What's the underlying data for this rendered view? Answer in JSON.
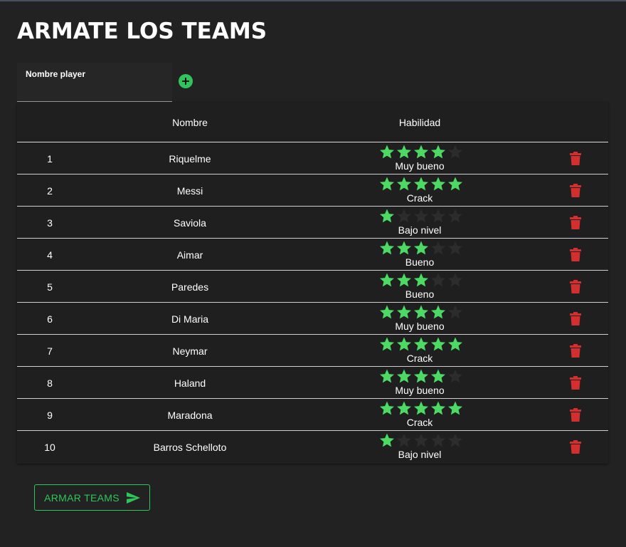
{
  "page": {
    "title": "ARMATE LOS TEAMS"
  },
  "player_input": {
    "label": "Nombre player",
    "value": "",
    "add_icon": "add-circle-icon"
  },
  "table": {
    "headers": {
      "name": "Nombre",
      "skill": "Habilidad"
    },
    "rows": [
      {
        "num": "1",
        "name": "Riquelme",
        "rating": 4,
        "label": "Muy bueno"
      },
      {
        "num": "2",
        "name": "Messi",
        "rating": 5,
        "label": "Crack"
      },
      {
        "num": "3",
        "name": "Saviola",
        "rating": 1,
        "label": "Bajo nivel"
      },
      {
        "num": "4",
        "name": "Aimar",
        "rating": 3,
        "label": "Bueno"
      },
      {
        "num": "5",
        "name": "Paredes",
        "rating": 3,
        "label": "Bueno"
      },
      {
        "num": "6",
        "name": "Di Maria",
        "rating": 4,
        "label": "Muy bueno"
      },
      {
        "num": "7",
        "name": "Neymar",
        "rating": 5,
        "label": "Crack"
      },
      {
        "num": "8",
        "name": "Haland",
        "rating": 4,
        "label": "Muy bueno"
      },
      {
        "num": "9",
        "name": "Maradona",
        "rating": 5,
        "label": "Crack"
      },
      {
        "num": "10",
        "name": "Barros Schelloto",
        "rating": 1,
        "label": "Bajo nivel"
      }
    ],
    "max_rating": 5,
    "delete_icon": "trash-icon"
  },
  "actions": {
    "armar_label": "ARMAR TEAMS",
    "armar_icon": "send-icon"
  },
  "colors": {
    "background": "#222222",
    "accent": "#2ec55a",
    "star_filled": "#4cd964",
    "star_empty": "#2c2c2c",
    "delete": "#d32f2f"
  }
}
